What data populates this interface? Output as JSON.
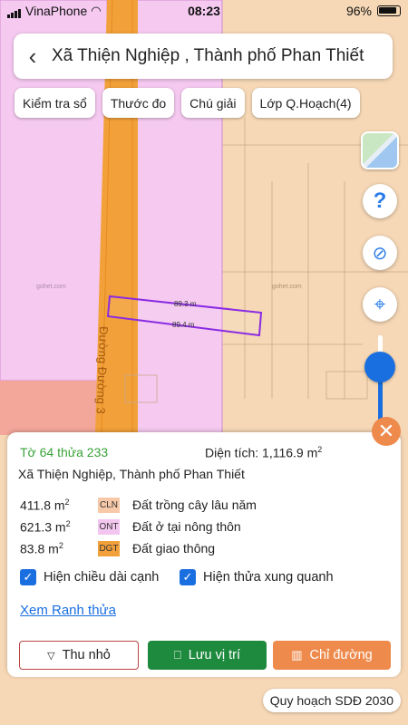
{
  "status": {
    "carrier": "VinaPhone",
    "time": "08:23",
    "battery": "96%"
  },
  "header": {
    "title": "Xã Thiện Nghiệp , Thành phố Phan Thiết"
  },
  "chips": [
    "Kiểm tra sổ",
    "Thước đo",
    "Chú giải",
    "Lớp Q.Hoạch(4)"
  ],
  "map": {
    "road_name": "Đường Đường 3",
    "parcel_edge_top": "89.3 m",
    "parcel_edge_bottom": "89.4 m",
    "watermark": "gohet.com",
    "colors": {
      "pink": "#f5c9f0",
      "orange": "#f2a13a",
      "beige": "#f6d8b6",
      "parcel_outline": "#8a2be2"
    }
  },
  "controls": {
    "zoom_level": 0.68
  },
  "panel": {
    "parcel_code": "Tờ 64 thửa 233",
    "area_label": "Diện tích: 1,116.9 m",
    "area_sup": "2",
    "location": "Xã Thiện Nghiệp, Thành phố Phan Thiết",
    "landuse": [
      {
        "area": "411.8 m",
        "sup": "2",
        "code": "CLN",
        "name": "Đất trồng cây lâu năm",
        "color": "#f7c9a8"
      },
      {
        "area": "621.3 m",
        "sup": "2",
        "code": "ONT",
        "name": "Đất ở tại nông thôn",
        "color": "#f3c6ef"
      },
      {
        "area": "83.8 m",
        "sup": "2",
        "code": "DGT",
        "name": "Đất giao thông",
        "color": "#f2a13a"
      }
    ],
    "check_edge": "Hiện chiều dài cạnh",
    "check_neighbors": "Hiện thửa xung quanh",
    "link": "Xem Ranh thửa",
    "btn_collapse": "Thu nhỏ",
    "btn_save": "Lưu vị trí",
    "btn_directions": "Chỉ đường"
  },
  "badge": "Quy hoạch SDĐ 2030"
}
